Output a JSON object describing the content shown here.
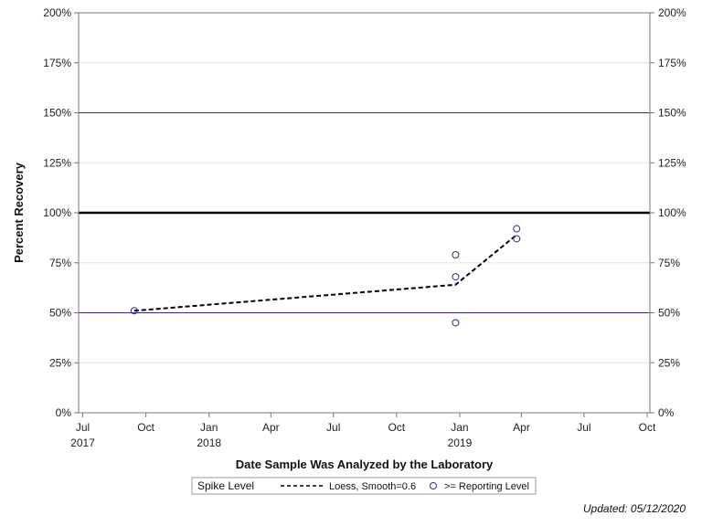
{
  "chart_data": {
    "type": "scatter",
    "xlabel": "Date Sample Was Analyzed by the Laboratory",
    "ylabel": "Percent Recovery",
    "ylim": [
      0,
      200
    ],
    "yticks": [
      0,
      25,
      50,
      75,
      100,
      125,
      150,
      175,
      200
    ],
    "ytick_labels": [
      "0%",
      "25%",
      "50%",
      "75%",
      "100%",
      "125%",
      "150%",
      "175%",
      "200%"
    ],
    "xlim": [
      "2017-06-25",
      "2019-10-05"
    ],
    "xticks": [
      {
        "date": "2017-07-01",
        "label": "Jul",
        "year": "2017"
      },
      {
        "date": "2017-10-01",
        "label": "Oct",
        "year": ""
      },
      {
        "date": "2018-01-01",
        "label": "Jan",
        "year": "2018"
      },
      {
        "date": "2018-04-01",
        "label": "Apr",
        "year": ""
      },
      {
        "date": "2018-07-01",
        "label": "Jul",
        "year": ""
      },
      {
        "date": "2018-10-01",
        "label": "Oct",
        "year": ""
      },
      {
        "date": "2019-01-01",
        "label": "Jan",
        "year": "2019"
      },
      {
        "date": "2019-04-01",
        "label": "Apr",
        "year": ""
      },
      {
        "date": "2019-07-01",
        "label": "Jul",
        "year": ""
      },
      {
        "date": "2019-10-01",
        "label": "Oct",
        "year": ""
      }
    ],
    "reference_lines": [
      {
        "y": 150,
        "color": "#2b2b9a",
        "style": "thin"
      },
      {
        "y": 100,
        "color": "#000000",
        "style": "thick"
      },
      {
        "y": 50,
        "color": "#2b2b9a",
        "style": "thin"
      }
    ],
    "series": [
      {
        "name": ">= Reporting Level",
        "type": "scatter",
        "color": "#2b2b9a",
        "marker": "open-circle",
        "points": [
          {
            "x": "2017-09-14",
            "y": 51
          },
          {
            "x": "2018-12-26",
            "y": 79
          },
          {
            "x": "2018-12-26",
            "y": 68
          },
          {
            "x": "2018-12-26",
            "y": 45
          },
          {
            "x": "2019-03-25",
            "y": 92
          },
          {
            "x": "2019-03-25",
            "y": 87
          }
        ]
      },
      {
        "name": "Loess, Smooth=0.6",
        "type": "line",
        "color": "#000000",
        "dash": "dashed",
        "points": [
          {
            "x": "2017-09-14",
            "y": 51
          },
          {
            "x": "2018-12-26",
            "y": 64
          },
          {
            "x": "2019-03-25",
            "y": 89
          }
        ]
      }
    ],
    "grid": true,
    "legend": {
      "title": "Spike Level",
      "position": "bottom-center",
      "entries": [
        "Loess, Smooth=0.6",
        ">= Reporting Level"
      ]
    }
  },
  "footer": {
    "updated": "Updated: 05/12/2020"
  }
}
